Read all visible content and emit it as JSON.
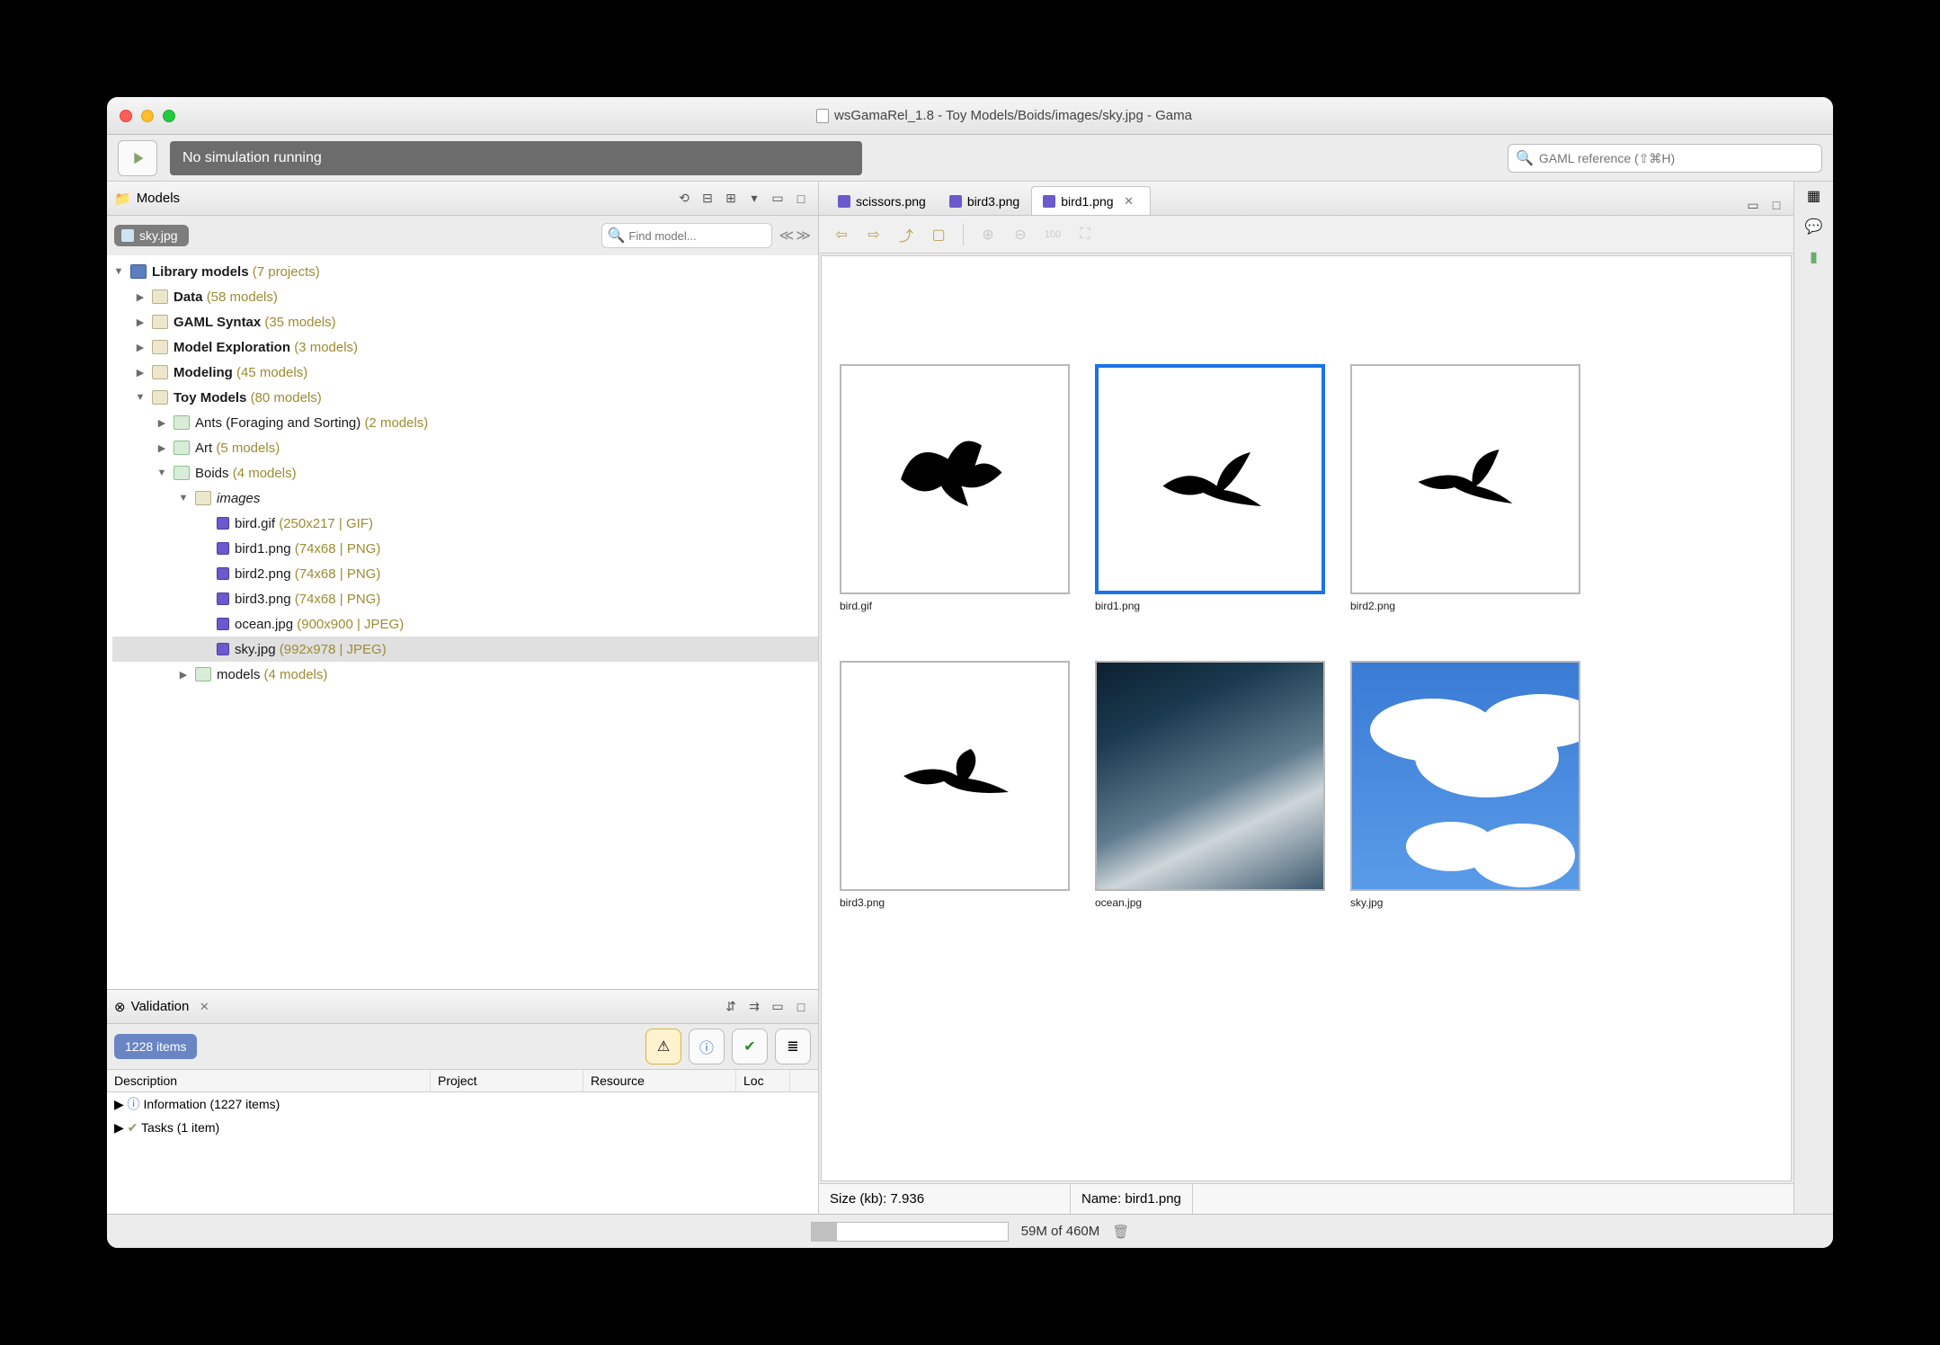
{
  "window_title": "wsGamaRel_1.8 - Toy Models/Boids/images/sky.jpg - Gama",
  "sim_status": "No simulation running",
  "search_placeholder": "GAML reference (⇧⌘H)",
  "models_view": {
    "title": "Models"
  },
  "chip_label": "sky.jpg",
  "find_placeholder": "Find model...",
  "tree": {
    "root": "Library models",
    "root_meta": "(7 projects)",
    "data": "Data",
    "data_meta": "(58 models)",
    "gaml": "GAML Syntax",
    "gaml_meta": "(35 models)",
    "explore": "Model Exploration",
    "explore_meta": "(3 models)",
    "modeling": "Modeling",
    "modeling_meta": "(45 models)",
    "toy": "Toy Models",
    "toy_meta": "(80 models)",
    "ants": "Ants (Foraging and Sorting)",
    "ants_meta": "(2 models)",
    "art": "Art",
    "art_meta": "(5 models)",
    "boids": "Boids",
    "boids_meta": "(4 models)",
    "images": "images",
    "f0": "bird.gif",
    "f0m": "(250x217 | GIF)",
    "f1": "bird1.png",
    "f1m": "(74x68 | PNG)",
    "f2": "bird2.png",
    "f2m": "(74x68 | PNG)",
    "f3": "bird3.png",
    "f3m": "(74x68 | PNG)",
    "f4": "ocean.jpg",
    "f4m": "(900x900 | JPEG)",
    "f5": "sky.jpg",
    "f5m": "(992x978 | JPEG)",
    "models_folder": "models",
    "models_folder_meta": "(4 models)"
  },
  "validation": {
    "title": "Validation",
    "count_chip": "1228 items",
    "cols": {
      "desc": "Description",
      "proj": "Project",
      "res": "Resource",
      "loc": "Loc"
    },
    "row_info": "Information (1227 items)",
    "row_tasks": "Tasks (1 item)"
  },
  "tabs": {
    "t0": "scissors.png",
    "t1": "bird3.png",
    "t2": "bird1.png"
  },
  "gallery": {
    "c0": "bird.gif",
    "c1": "bird1.png",
    "c2": "bird2.png",
    "c3": "bird3.png",
    "c4": "ocean.jpg",
    "c5": "sky.jpg"
  },
  "img_status": {
    "size": "Size (kb): 7.936",
    "name": "Name: bird1.png"
  },
  "footer": {
    "mem": "59M of 460M"
  }
}
